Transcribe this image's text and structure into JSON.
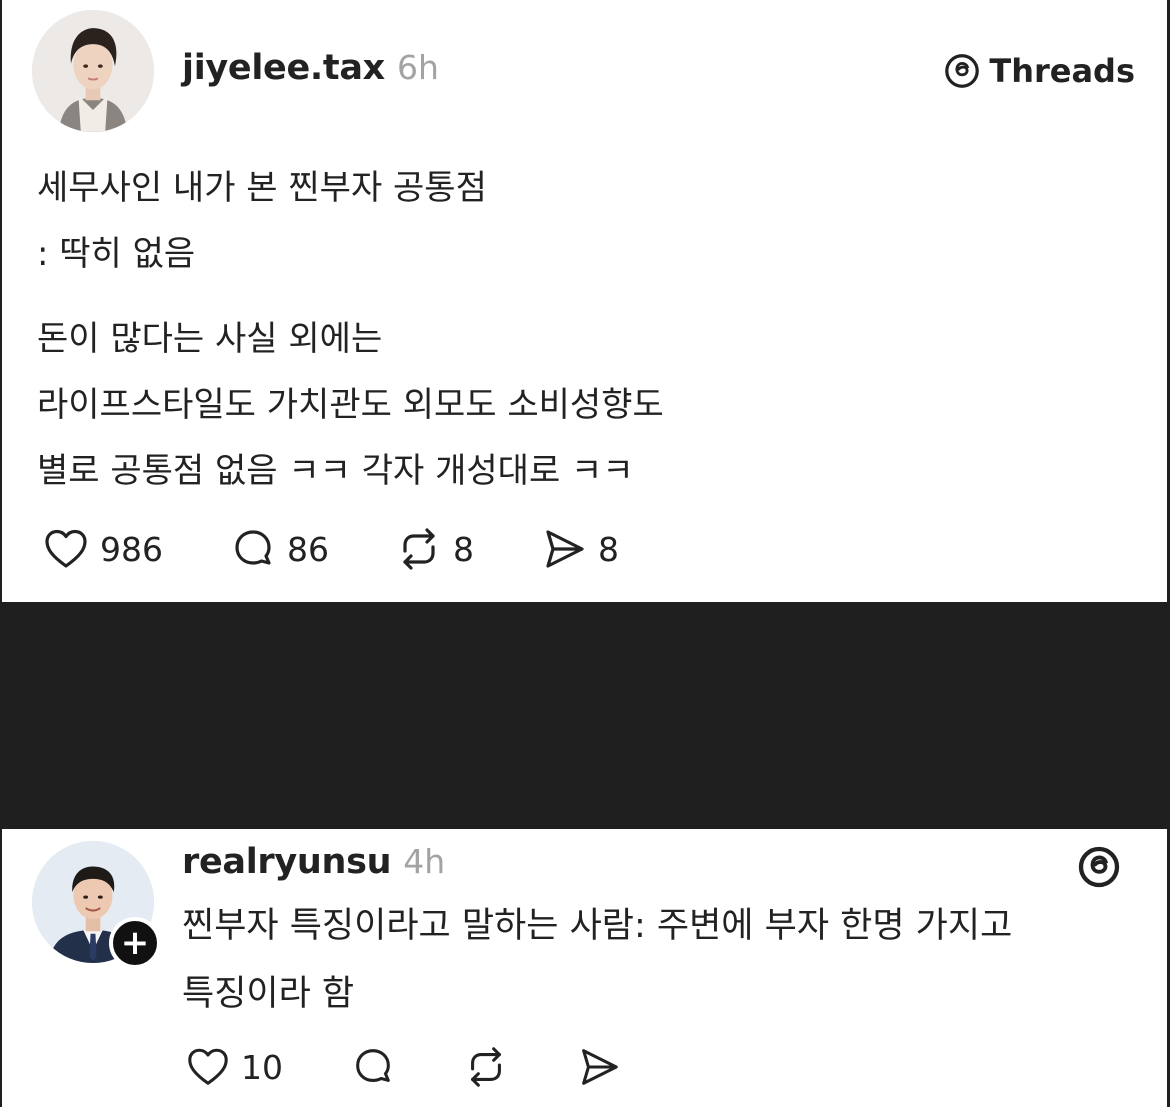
{
  "posts": [
    {
      "username": "jiyelee.tax",
      "time": "6h",
      "brand": "Threads",
      "paragraphs": [
        [
          "세무사인 내가 본 찐부자 공통점",
          ": 딱히 없음"
        ],
        [
          "돈이 많다는 사실 외에는",
          "라이프스타일도 가치관도 외모도 소비성향도",
          "별로 공통점 없음 ㅋㅋ 각자 개성대로 ㅋㅋ"
        ]
      ],
      "stats": {
        "likes": "986",
        "replies": "86",
        "reposts": "8",
        "shares": "8"
      },
      "icons": [
        "heart-icon",
        "reply-icon",
        "repost-icon",
        "share-icon",
        "threads-logo-icon"
      ]
    },
    {
      "username": "realryunsu",
      "time": "4h",
      "lines": [
        "찐부자 특징이라고 말하는 사람: 주변에 부자 한명 가지고",
        "특징이라 함"
      ],
      "stats": {
        "likes": "10"
      },
      "follow_badge": "+",
      "icons": [
        "heart-icon",
        "reply-icon",
        "repost-icon",
        "share-icon",
        "threads-logo-icon",
        "plus-icon"
      ]
    }
  ],
  "colors": {
    "background": "#1f1f1f",
    "card": "#ffffff",
    "muted": "#a3a3a3",
    "text": "#222222"
  }
}
